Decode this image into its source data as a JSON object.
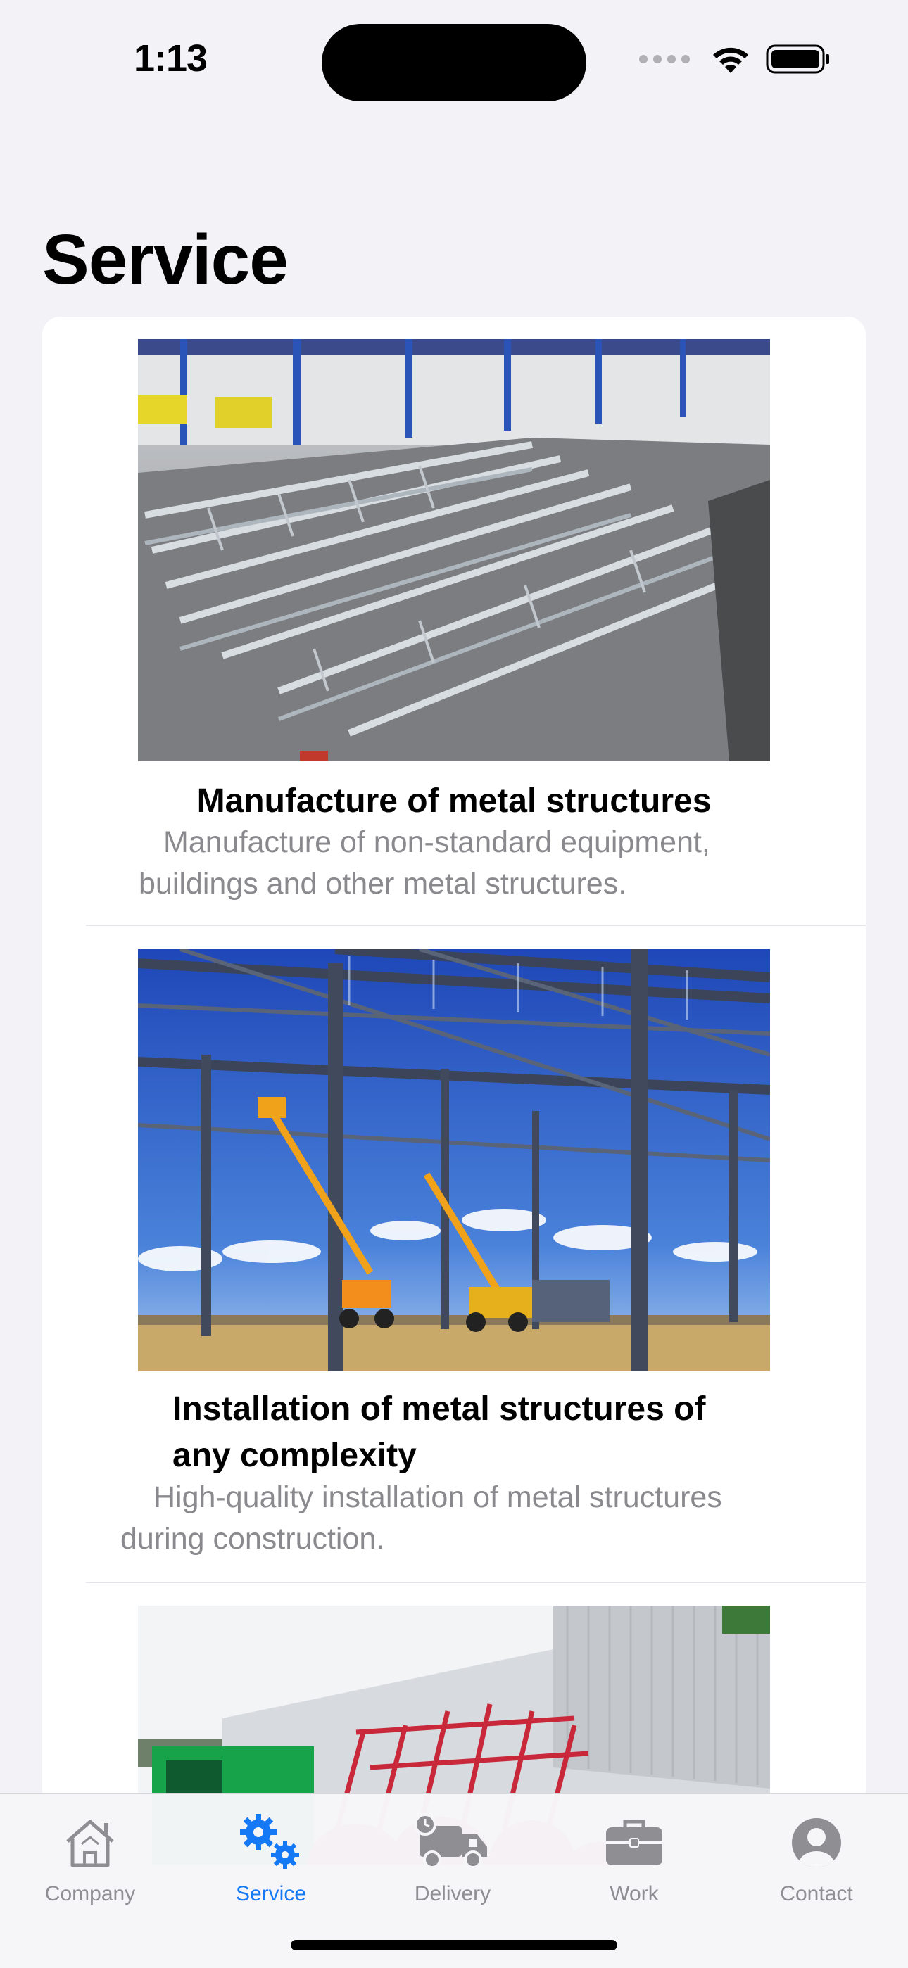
{
  "status": {
    "time": "1:13"
  },
  "page_title": "Service",
  "services": [
    {
      "title": "Manufacture of metal structures",
      "description_lines": [
        "Manufacture of non-standard equipment,",
        "buildings and other metal structures."
      ],
      "image": "stacked-steel-trusses-photo"
    },
    {
      "title_lines": [
        "Installation of metal structures of",
        "any complexity"
      ],
      "description_lines": [
        "High-quality installation of metal structures",
        "during construction."
      ],
      "image": "steel-frame-construction-photo"
    },
    {
      "image": "red-metal-containers-photo"
    }
  ],
  "tabbar": {
    "accent": "#1578f5",
    "inactive": "#8e8e93",
    "tabs": [
      {
        "label": "Company",
        "icon": "house-icon"
      },
      {
        "label": "Service",
        "icon": "gears-icon",
        "selected": true
      },
      {
        "label": "Delivery",
        "icon": "truck-clock-icon"
      },
      {
        "label": "Work",
        "icon": "briefcase-icon"
      },
      {
        "label": "Contact",
        "icon": "person-circle-icon"
      }
    ]
  }
}
